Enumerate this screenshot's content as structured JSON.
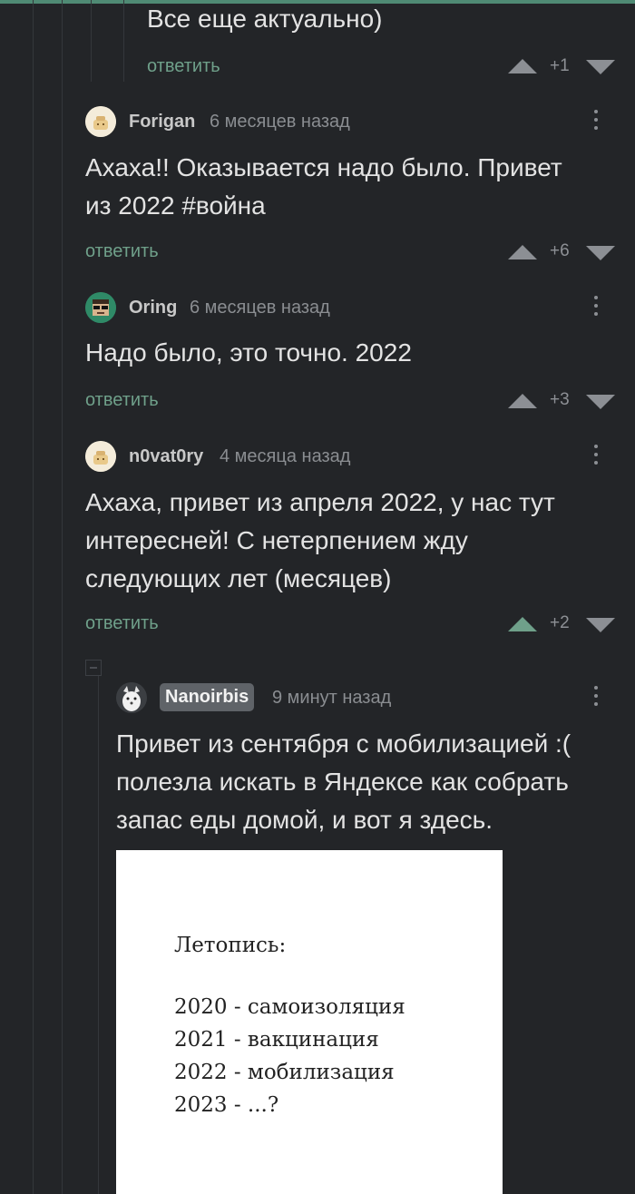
{
  "top_comment": {
    "text": "Все еще актуально)",
    "reply_label": "ответить",
    "score": "+1"
  },
  "comments": [
    {
      "author": "Forigan",
      "time": "6 месяцев назад",
      "text_lines": [
        "Ахаха!! Оказывается надо было. Привет",
        "из 2022 #война"
      ],
      "reply_label": "ответить",
      "score": "+6"
    },
    {
      "author": "Oring",
      "time": "6 месяцев назад",
      "text_lines": [
        "Надо было, это точно. 2022"
      ],
      "reply_label": "ответить",
      "score": "+3"
    },
    {
      "author": "n0vat0ry",
      "time": "4 месяца назад",
      "text_lines": [
        "Ахаха, привет из апреля 2022, у нас тут",
        "интересней! С нетерпением жду",
        "следующих лет (месяцев)"
      ],
      "reply_label": "ответить",
      "score": "+2"
    }
  ],
  "nested_comment": {
    "author": "Nanoirbis",
    "time": "9 минут назад",
    "text_lines": [
      "Привет из сентября с мобилизацией :(",
      "полезла искать в Яндексе как собрать",
      "запас еды домой, и вот я здесь."
    ],
    "image": {
      "heading": "Летопись:",
      "lines": [
        "2020 - самоизоляция",
        "2021 - вакцинация",
        "2022 - мобилизация",
        "2023 - ...?"
      ]
    }
  },
  "colors": {
    "background": "#232528",
    "accent": "#6fa08a",
    "muted": "#8c8f94"
  },
  "icons": [
    "upvote-icon",
    "downvote-icon",
    "more-menu-icon",
    "collapse-icon"
  ]
}
